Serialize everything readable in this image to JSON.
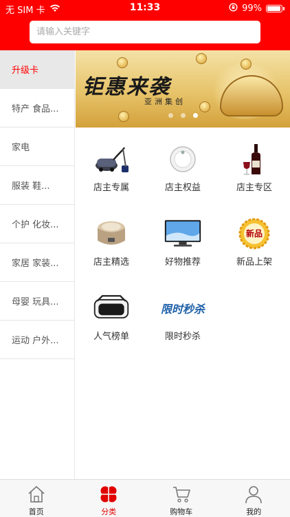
{
  "status_bar": {
    "carrier": "无 SIM 卡",
    "time": "11:33",
    "battery": "99%"
  },
  "search": {
    "placeholder": "请输入关键字"
  },
  "sidebar": {
    "items": [
      {
        "label": "升级卡",
        "active": true
      },
      {
        "label": "特产 食品..."
      },
      {
        "label": "家电"
      },
      {
        "label": "服装 鞋..."
      },
      {
        "label": "个护 化妆..."
      },
      {
        "label": "家居 家装..."
      },
      {
        "label": "母婴 玩具..."
      },
      {
        "label": "运动 户外..."
      }
    ]
  },
  "banner": {
    "title": "钜惠来袭",
    "subtitle": "亚洲集创",
    "slide_count": 3,
    "active_slide": 3
  },
  "grid": {
    "items": [
      {
        "label": "店主专属",
        "icon": "vacuum-cleaner-icon"
      },
      {
        "label": "店主权益",
        "icon": "robot-vacuum-icon"
      },
      {
        "label": "店主专区",
        "icon": "wine-bottle-icon"
      },
      {
        "label": "店主精选",
        "icon": "rice-cooker-icon"
      },
      {
        "label": "好物推荐",
        "icon": "tv-monitor-icon"
      },
      {
        "label": "新品上架",
        "icon": "new-badge-icon",
        "badge_text": "新品"
      },
      {
        "label": "人气榜单",
        "icon": "vr-headset-icon"
      },
      {
        "label": "限时秒杀",
        "icon": "flash-sale-logo",
        "logo_text": "限时秒杀"
      }
    ]
  },
  "tabbar": {
    "items": [
      {
        "label": "首页",
        "icon": "home-icon"
      },
      {
        "label": "分类",
        "icon": "category-clover-icon",
        "active": true
      },
      {
        "label": "购物车",
        "icon": "cart-icon"
      },
      {
        "label": "我的",
        "icon": "profile-icon"
      }
    ]
  },
  "colors": {
    "brand_red": "#fe0000",
    "active_text": "#ff0000",
    "sidebar_active_bg": "#e8e8e8",
    "tab_active": "#e10000"
  }
}
